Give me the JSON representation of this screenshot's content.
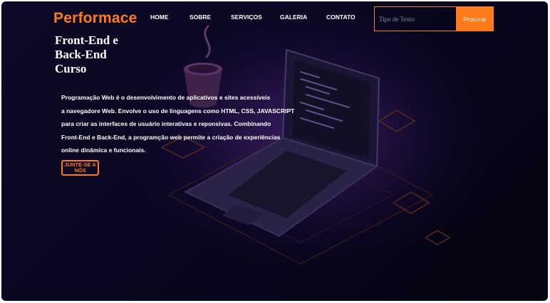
{
  "header": {
    "logo": "Performace",
    "nav": [
      "HOME",
      "SOBRE",
      "SERVIÇOS",
      "GALERIA",
      "CONTATO"
    ],
    "search": {
      "placeholder": "Tipo de Texto",
      "button": "Procurar"
    }
  },
  "hero": {
    "title_lines": [
      "Front-End e",
      "Back-End",
      "Curso"
    ],
    "description_lines": [
      "Programação Web é o desenvolvimento de aplicativos e sites acessíveis",
      "a navegadore Web. Envolve o uso de linguagens como HTML, CSS, JAVASCRIPT",
      "para criar as interfaces de usuário interativas e reponsivas. Combinando",
      "Front-End e Back-End, a programção web permite a criação de experiências",
      "online dinâmica e funcionais."
    ],
    "cta": "JUNTE-SE A NÓS"
  },
  "colors": {
    "accent": "#ff7a1a",
    "background": "#090720",
    "text": "#ffffff"
  },
  "background_illustration": [
    "laptop-icon",
    "coffee-cup-icon",
    "code-screen-icon"
  ]
}
